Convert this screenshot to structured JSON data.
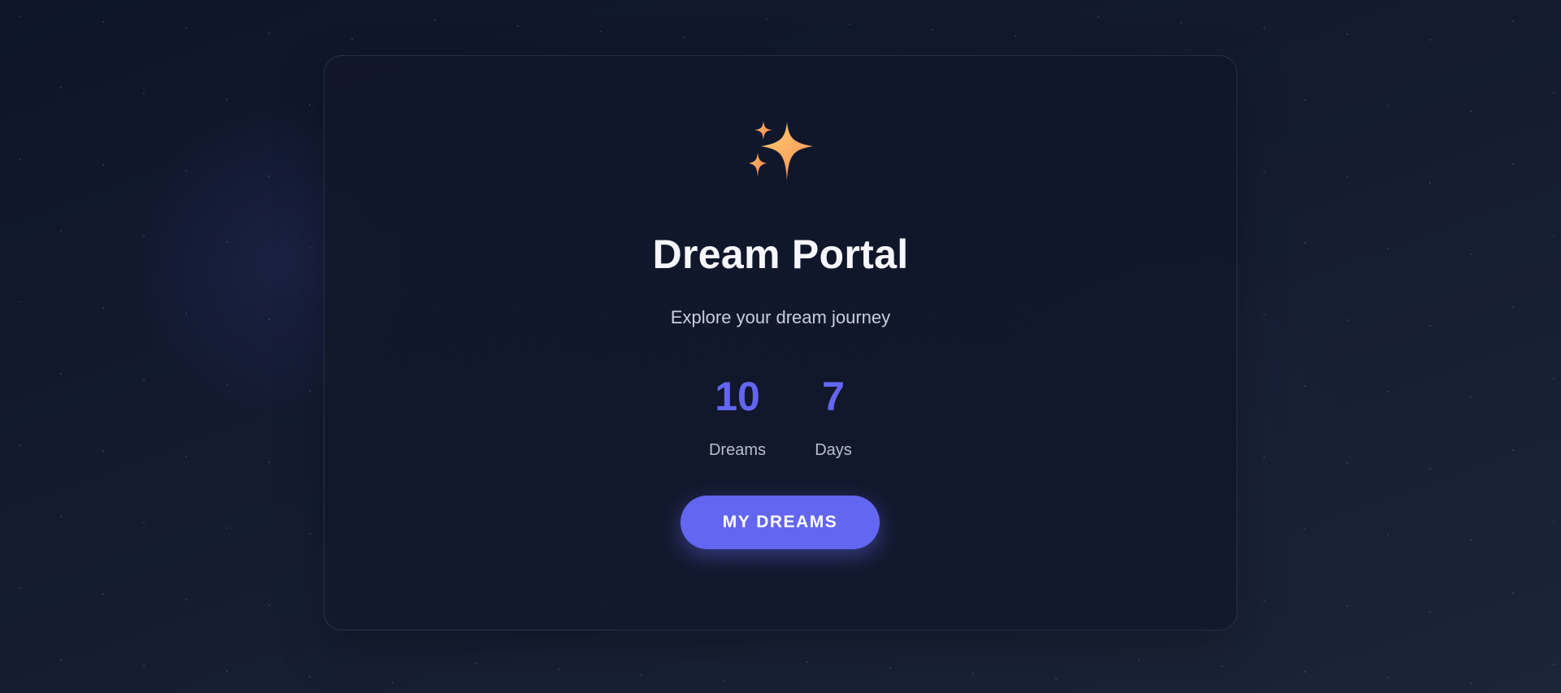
{
  "header": {
    "logo_icon": "sparkles-icon",
    "title": "Dream Portal",
    "subtitle": "Explore your dream journey"
  },
  "stats": [
    {
      "value": "10",
      "label": "Dreams"
    },
    {
      "value": "7",
      "label": "Days"
    }
  ],
  "cta": {
    "label": "MY DREAMS"
  },
  "colors": {
    "accent": "#6366f1",
    "background": "#141b31",
    "title": "#f5f7fb",
    "muted_text": "#c9cedb",
    "sparkle_primary": "#ffb347",
    "sparkle_secondary": "#ff8a65"
  }
}
